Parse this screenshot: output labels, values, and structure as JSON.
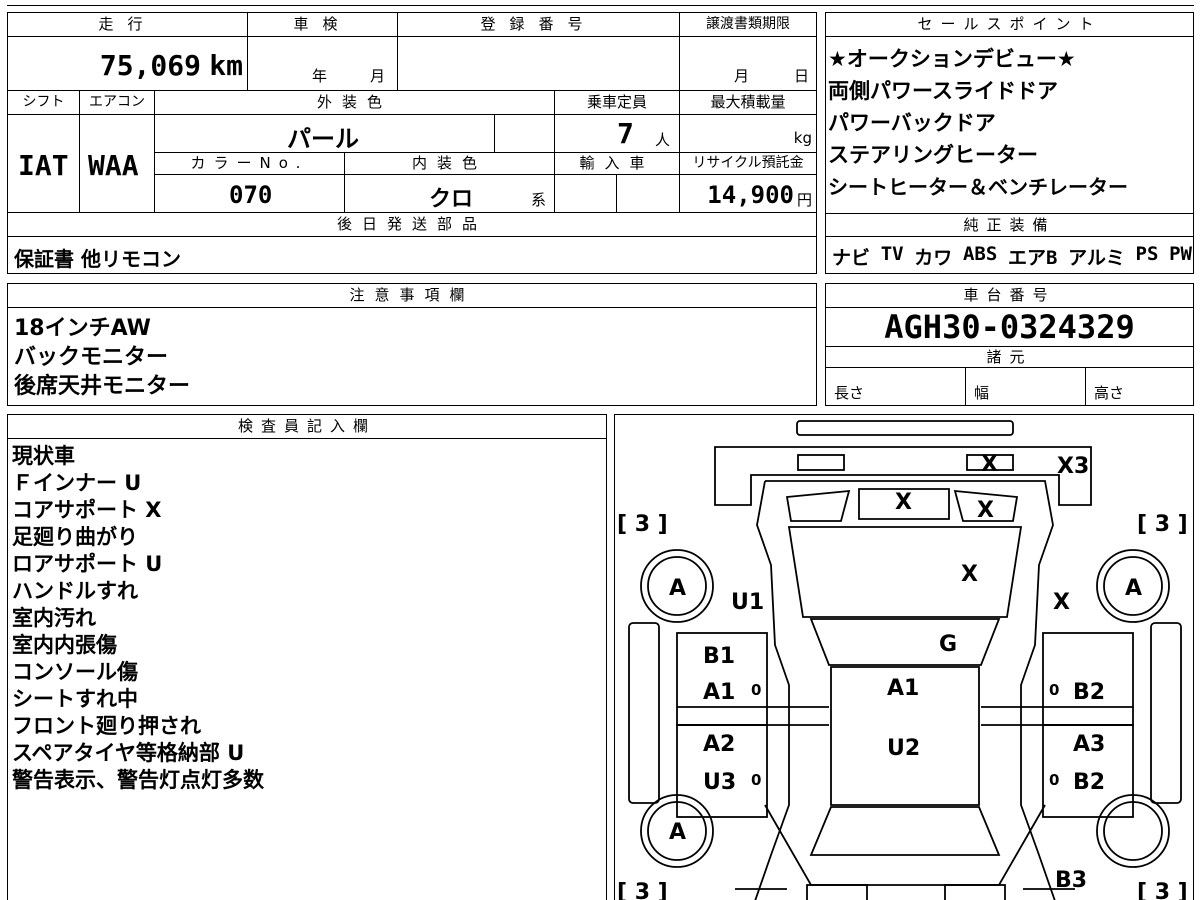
{
  "main": {
    "mileage_label": "走行",
    "mileage_value": "75,069",
    "mileage_unit": "km",
    "shaken_label": "車検",
    "shaken_year_unit": "年",
    "shaken_month_unit": "月",
    "reg_label": "登録番号",
    "transfer_label": "譲渡書類期限",
    "transfer_month_unit": "月",
    "transfer_day_unit": "日",
    "shift_label": "シフト",
    "shift_value": "IAT",
    "ac_label": "エアコン",
    "ac_value": "WAA",
    "exterior_label": "外装色",
    "exterior_value": "パール",
    "capacity_label": "乗車定員",
    "capacity_value": "7",
    "capacity_unit": "人",
    "maxload_label": "最大積載量",
    "maxload_unit": "kg",
    "color_no_label": "カラーNo.",
    "color_no_value": "070",
    "interior_label": "内装色",
    "interior_value": "クロ",
    "interior_unit": "系",
    "import_label": "輸入車",
    "recycle_label": "リサイクル預託金",
    "recycle_value": "14,900",
    "recycle_unit": "円",
    "later_label": "後日発送部品",
    "later_value": "保証書 他リモコン"
  },
  "sales": {
    "label": "セールスポイント",
    "items": [
      "★オークションデビュー★",
      "両側パワースライドドア",
      "パワーバックドア",
      "ステアリングヒーター",
      "シートヒーター＆ベンチレーター"
    ]
  },
  "equipment": {
    "label": "純正装備",
    "items": [
      "ナビ",
      "TV",
      "カワ",
      "ABS",
      "エアB",
      "アルミ",
      "PS",
      "PW"
    ]
  },
  "notes": {
    "label": "注意事項欄",
    "items": [
      "18インチAW",
      "バックモニター",
      "後席天井モニター"
    ]
  },
  "chassis": {
    "label": "車台番号",
    "value": "AGH30-0324329",
    "spec_label": "諸元",
    "length_label": "長さ",
    "width_label": "幅",
    "height_label": "高さ"
  },
  "inspector": {
    "label": "検査員記入欄",
    "items": [
      "現状車",
      "Ｆインナー U",
      "コアサポート X",
      "足廻り曲がり",
      "ロアサポート U",
      "ハンドルすれ",
      "室内汚れ",
      "室内内張傷",
      "コンソール傷",
      "シートすれ中",
      "フロント廻り押され",
      "スペアタイヤ等格納部 U",
      "警告表示、警告灯点灯多数"
    ]
  },
  "diagram": {
    "tread_fl": "[ 3 ]",
    "tread_fr": "[ 3 ]",
    "tread_rl": "[ 3 ]",
    "tread_rr": "[ 3 ]",
    "tire_fl": "A",
    "tire_fr": "A",
    "tire_rl": "A",
    "marks": {
      "front_top_x": "X",
      "front_x3": "X3",
      "grille_x": "X",
      "light_x": "X",
      "hood_x": "X",
      "fender_r_x": "X",
      "fender_l_u1": "U1",
      "windshield_g": "G",
      "door_fl_b1": "B1",
      "door_fl_a1": "A1",
      "roof_a1": "A1",
      "door_fr_b2": "B2",
      "door_rl_a2": "A2",
      "door_rl_u3": "U3",
      "roof_u2": "U2",
      "door_rr_a3": "A3",
      "door_rr_b2": "B2",
      "rear_b3": "B3",
      "pillar_fl": "0",
      "pillar_fr": "0",
      "pillar_rl": "0",
      "pillar_rr": "0"
    }
  }
}
